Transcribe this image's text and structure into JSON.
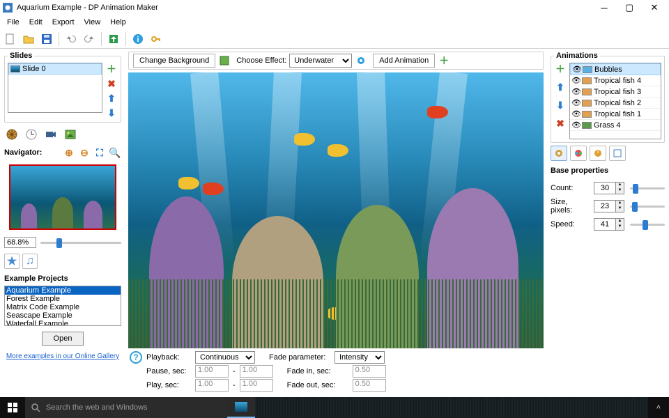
{
  "title": "Aquarium Example - DP Animation Maker",
  "menu": [
    "File",
    "Edit",
    "Export",
    "View",
    "Help"
  ],
  "slides": {
    "legend": "Slides",
    "items": [
      "Slide 0"
    ]
  },
  "navigator": {
    "label": "Navigator:",
    "zoom": "68.8%"
  },
  "examples": {
    "title": "Example Projects",
    "items": [
      "Aquarium Example",
      "Forest Example",
      "Matrix Code Example",
      "Seascape Example",
      "Waterfall Example"
    ],
    "open": "Open",
    "link": "More examples in our Online Gallery"
  },
  "centerTop": {
    "changeBg": "Change Background",
    "chooseEffect": "Choose Effect:",
    "effectValue": "Underwater",
    "addAnim": "Add Animation"
  },
  "playback": {
    "playbackLabel": "Playback:",
    "playbackValue": "Continuous",
    "pauseLabel": "Pause, sec:",
    "pauseMin": "1.00",
    "pauseMax": "1.00",
    "playLabel": "Play, sec:",
    "playMin": "1.00",
    "playMax": "1.00",
    "fadeParamLabel": "Fade parameter:",
    "fadeParamValue": "Intensity",
    "fadeInLabel": "Fade in, sec:",
    "fadeInVal": "0.50",
    "fadeOutLabel": "Fade out, sec:",
    "fadeOutVal": "0.50"
  },
  "animations": {
    "legend": "Animations",
    "items": [
      "Bubbles",
      "Tropical fish 4",
      "Tropical fish 3",
      "Tropical fish 2",
      "Tropical fish 1",
      "Grass 4"
    ]
  },
  "baseProps": {
    "title": "Base properties",
    "count": {
      "label": "Count:",
      "value": "30"
    },
    "size": {
      "label": "Size, pixels:",
      "value": "23"
    },
    "speed": {
      "label": "Speed:",
      "value": "41"
    }
  },
  "taskbar": {
    "search": "Search the web and Windows"
  }
}
